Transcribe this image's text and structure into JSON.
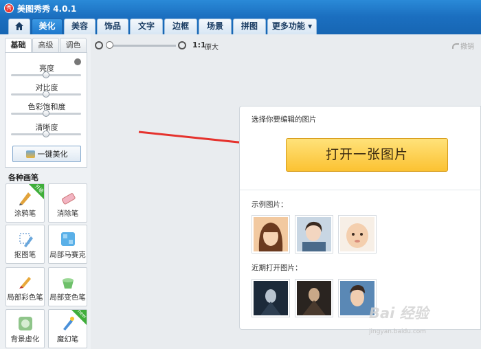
{
  "app": {
    "title": "美图秀秀 4.0.1",
    "logo_text": "秀"
  },
  "tabs": [
    {
      "label": ""
    },
    {
      "label": "美化"
    },
    {
      "label": "美容"
    },
    {
      "label": "饰品"
    },
    {
      "label": "文字"
    },
    {
      "label": "边框"
    },
    {
      "label": "场景"
    },
    {
      "label": "拼图"
    },
    {
      "label": "更多功能 ▾"
    }
  ],
  "subtabs": [
    "基础",
    "高级",
    "调色"
  ],
  "sliders": [
    {
      "label": "亮度",
      "value": 0.5
    },
    {
      "label": "对比度",
      "value": 0.5
    },
    {
      "label": "色彩饱和度",
      "value": 0.5
    },
    {
      "label": "清晰度",
      "value": 0.5
    }
  ],
  "onekey_button": "一键美化",
  "brushes": {
    "title": "各种画笔",
    "items": [
      {
        "label": "涂鸦笔",
        "badge": "升级",
        "icon": "doodle-pen-icon"
      },
      {
        "label": "消除笔",
        "badge": "",
        "icon": "eraser-icon"
      },
      {
        "label": "抠图笔",
        "badge": "",
        "icon": "cutout-pen-icon"
      },
      {
        "label": "局部马赛克",
        "badge": "",
        "icon": "mosaic-icon"
      },
      {
        "label": "局部彩色笔",
        "badge": "",
        "icon": "color-brush-icon"
      },
      {
        "label": "局部变色笔",
        "badge": "",
        "icon": "recolor-bucket-icon"
      },
      {
        "label": "背景虚化",
        "badge": "",
        "icon": "background-blur-icon"
      },
      {
        "label": "魔幻笔",
        "badge": "new",
        "icon": "magic-wand-icon"
      }
    ]
  },
  "zoom": {
    "ratio_label": "1:1",
    "original_label": "原大"
  },
  "undo_label": "撤销",
  "card": {
    "heading": "选择你要编辑的图片",
    "open_button": "打开一张图片",
    "sample_label": "示例图片：",
    "recent_label": "近期打开图片："
  },
  "watermark": {
    "text": "Bai 经验",
    "sub": "jingyan.baidu.com"
  }
}
